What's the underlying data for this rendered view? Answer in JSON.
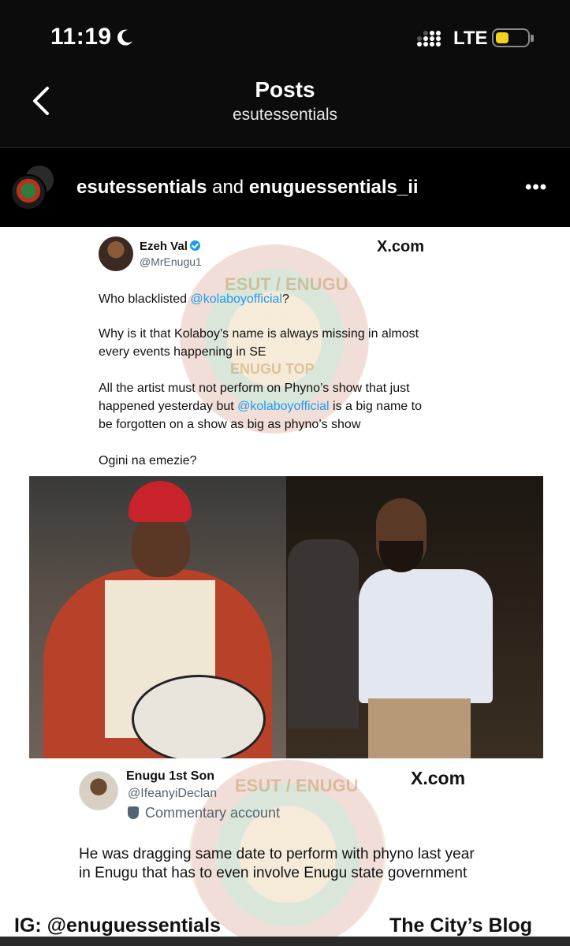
{
  "status_bar": {
    "time": "11:19",
    "network": "LTE",
    "battery_level": 0.42,
    "icons": [
      "moon-icon",
      "signal-icon",
      "battery-icon"
    ]
  },
  "nav": {
    "title": "Posts",
    "subtitle": "esutessentials",
    "back_icon": "chevron-left-icon"
  },
  "post": {
    "author_primary": "esutessentials",
    "connector": " and ",
    "author_secondary": "enuguessentials_ii",
    "more_label": "•••"
  },
  "image_content": {
    "tweet1": {
      "name": "Ezeh Val",
      "handle": "@MrEnugu1",
      "source": "X.com",
      "line1_pre": "Who blacklisted ",
      "mention": "@kolaboyofficial",
      "line1_post": "?",
      "para2": "Why is it that Kolaboy’s name is always missing in almost every events happening in SE",
      "para3_pre": "All the artist must not perform on Phyno’s show that just happened yesterday but ",
      "para3_post": " is a big name to be forgotten on a show as big as phyno’s show",
      "para4": "Ogini na emezie?"
    },
    "tweet2": {
      "name": "Enugu 1st Son",
      "handle": "@IfeanyiDeclan",
      "label": "Commentary account",
      "source": "X.com",
      "text": "He was dragging same date to perform with phyno last year in Enugu that has to even involve Enugu state government"
    },
    "footer_left": "IG: @enuguessentials",
    "footer_right": "The City’s Blog",
    "watermark_top": "ESUT / ENUGU",
    "watermark_mid": "ENUGU TOP"
  },
  "colors": {
    "background": "#000000",
    "mention": "#1d9bf0",
    "battery": "#f4d21f",
    "verified": "#1d9bf0"
  }
}
